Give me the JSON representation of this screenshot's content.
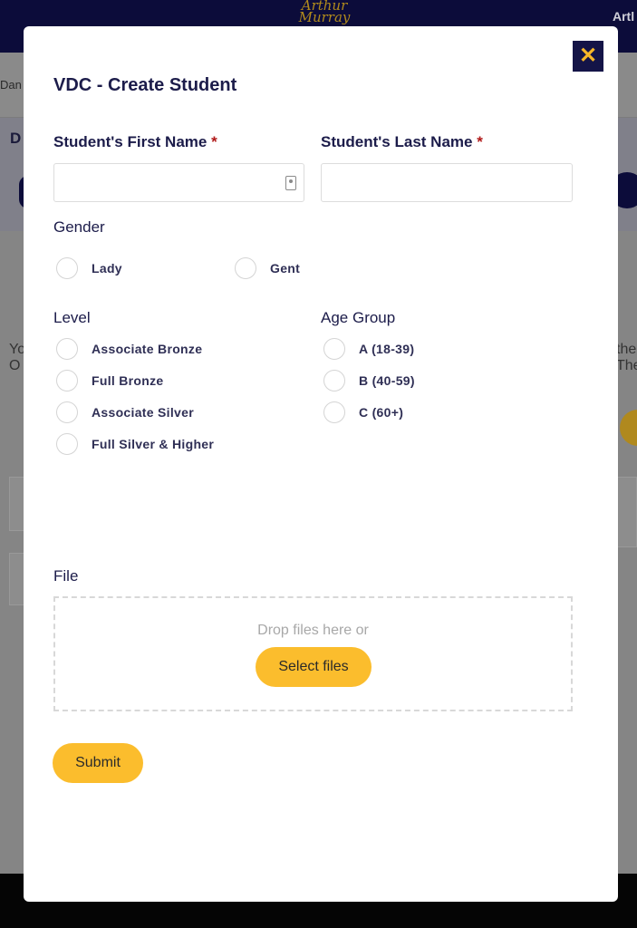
{
  "background": {
    "logo_line1": "Arthur",
    "logo_line2": "Murray",
    "user_name_fragment": "Artl",
    "tab_fragment": "Dan",
    "heading_fragment": "D",
    "text_left_line1": "Yo",
    "text_left_line2": "O",
    "text_right_line1": "the",
    "text_right_line2": "The"
  },
  "modal": {
    "title": "VDC - Create Student",
    "close_icon": "close-icon",
    "first_name": {
      "label": "Student's First Name",
      "required_mark": "*",
      "value": "",
      "icon": "contact-card-icon"
    },
    "last_name": {
      "label": "Student's Last Name",
      "required_mark": "*",
      "value": ""
    },
    "gender": {
      "label": "Gender",
      "options": [
        "Lady",
        "Gent"
      ]
    },
    "level": {
      "label": "Level",
      "options": [
        "Associate Bronze",
        "Full Bronze",
        "Associate Silver",
        "Full Silver & Higher"
      ]
    },
    "age_group": {
      "label": "Age Group",
      "options": [
        "A (18-39)",
        "B (40-59)",
        "C (60+)"
      ]
    },
    "file": {
      "label": "File",
      "drop_text": "Drop files here or",
      "select_label": "Select files"
    },
    "submit_label": "Submit"
  },
  "colors": {
    "navy": "#141447",
    "gold": "#fbbd2d",
    "required": "#b01818"
  }
}
